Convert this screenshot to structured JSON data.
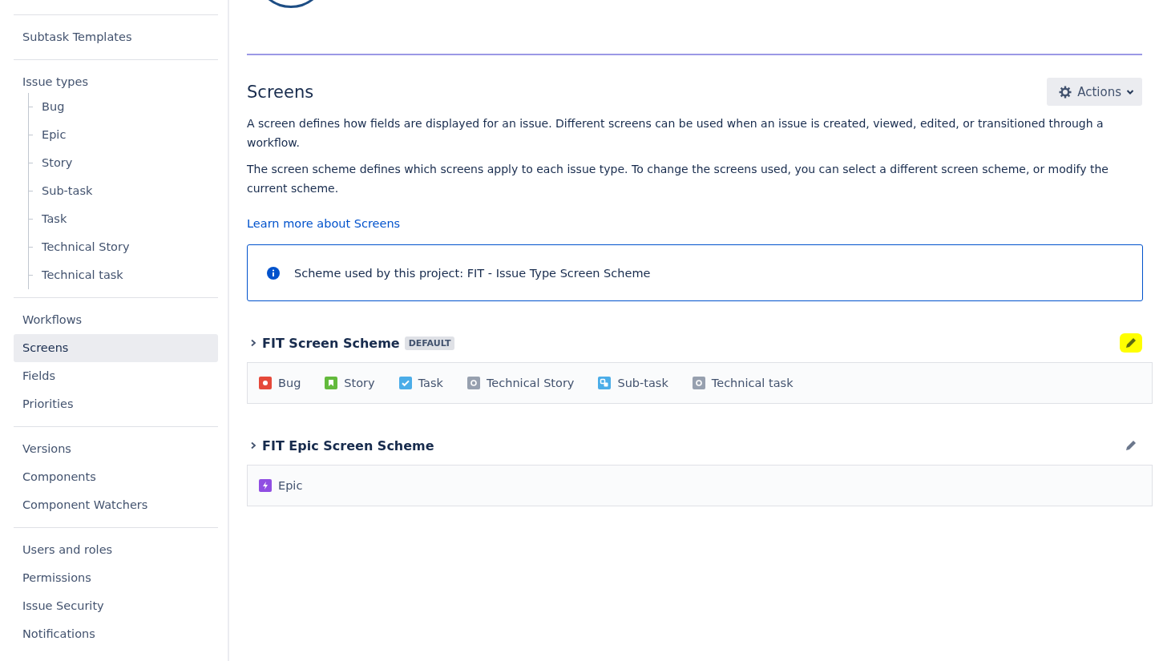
{
  "sidebar": {
    "groups": [
      {
        "items": [
          {
            "label": "Subtask Templates",
            "selected": false
          }
        ]
      },
      {
        "items": [
          {
            "label": "Issue types",
            "selected": false,
            "children": [
              {
                "label": "Bug",
                "selected": false
              },
              {
                "label": "Epic",
                "selected": false
              },
              {
                "label": "Story",
                "selected": false
              },
              {
                "label": "Sub-task",
                "selected": false
              },
              {
                "label": "Task",
                "selected": false
              },
              {
                "label": "Technical Story",
                "selected": false
              },
              {
                "label": "Technical task",
                "selected": false
              }
            ]
          }
        ]
      },
      {
        "items": [
          {
            "label": "Workflows",
            "selected": false
          },
          {
            "label": "Screens",
            "selected": true
          },
          {
            "label": "Fields",
            "selected": false
          },
          {
            "label": "Priorities",
            "selected": false
          }
        ]
      },
      {
        "items": [
          {
            "label": "Versions",
            "selected": false
          },
          {
            "label": "Components",
            "selected": false
          },
          {
            "label": "Component Watchers",
            "selected": false
          }
        ]
      },
      {
        "items": [
          {
            "label": "Users and roles",
            "selected": false
          },
          {
            "label": "Permissions",
            "selected": false
          },
          {
            "label": "Issue Security",
            "selected": false
          },
          {
            "label": "Notifications",
            "selected": false
          }
        ]
      }
    ]
  },
  "page": {
    "title": "Screens",
    "actions_button": "Actions",
    "paragraphs": [
      "A screen defines how fields are displayed for an issue. Different screens can be used when an issue is created, viewed, edited, or transitioned through a workflow.",
      "The screen scheme defines which screens apply to each issue type. To change the screens used, you can select a different screen scheme, or modify the current scheme."
    ],
    "learn_more_link": "Learn more about Screens",
    "info_message": "Scheme used by this project: FIT - Issue Type Screen Scheme",
    "schemes": [
      {
        "name": "FIT Screen Scheme",
        "badge": "DEFAULT",
        "highlighted": true,
        "issue_types": [
          {
            "label": "Bug",
            "kind": "bug",
            "color": "#e5493a"
          },
          {
            "label": "Story",
            "kind": "story",
            "color": "#63ba3c"
          },
          {
            "label": "Task",
            "kind": "task",
            "color": "#4bade8"
          },
          {
            "label": "Technical Story",
            "kind": "generic",
            "color": "#97a0af"
          },
          {
            "label": "Sub-task",
            "kind": "subtask",
            "color": "#4bade8"
          },
          {
            "label": "Technical task",
            "kind": "generic",
            "color": "#97a0af"
          }
        ]
      },
      {
        "name": "FIT Epic Screen Scheme",
        "highlighted": false,
        "issue_types": [
          {
            "label": "Epic",
            "kind": "epic",
            "color": "#904ee2"
          }
        ]
      }
    ]
  }
}
